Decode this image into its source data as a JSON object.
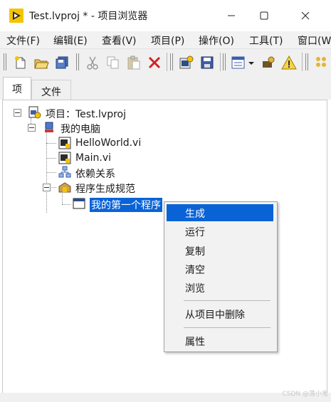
{
  "window": {
    "title": "Test.lvproj * - 项目浏览器",
    "min_glyph": "—",
    "max_glyph": "☐",
    "close_glyph": "✕"
  },
  "menu": [
    "文件(F)",
    "编辑(E)",
    "查看(V)",
    "项目(P)",
    "操作(O)",
    "工具(T)",
    "窗口(W"
  ],
  "toolbar": {
    "icons": [
      "new-icon",
      "open-icon",
      "save-all-icon",
      "cut-icon",
      "copy-icon",
      "paste-icon",
      "delete-icon",
      "build-icon",
      "save-icon",
      "view-icon",
      "dropdown-icon",
      "key-icon",
      "warning-icon",
      "more-icon"
    ]
  },
  "tabs": [
    "项",
    "文件"
  ],
  "tree": {
    "project": "项目：Test.lvproj",
    "my_computer": "我的电脑",
    "items": [
      "HelloWorld.vi",
      "Main.vi",
      "依赖关系",
      "程序生成规范"
    ],
    "selected": "我的第一个程序"
  },
  "context_menu": {
    "build": "生成",
    "run": "运行",
    "copy": "复制",
    "clear": "清空",
    "browse": "浏览",
    "remove": "从项目中删除",
    "properties": "属性"
  },
  "watermark": "CSDN @落小鬼",
  "colors": {
    "selection": "#0a63d6",
    "menu_bg": "#f2f2f2",
    "logo_yellow": "#f5c400"
  }
}
